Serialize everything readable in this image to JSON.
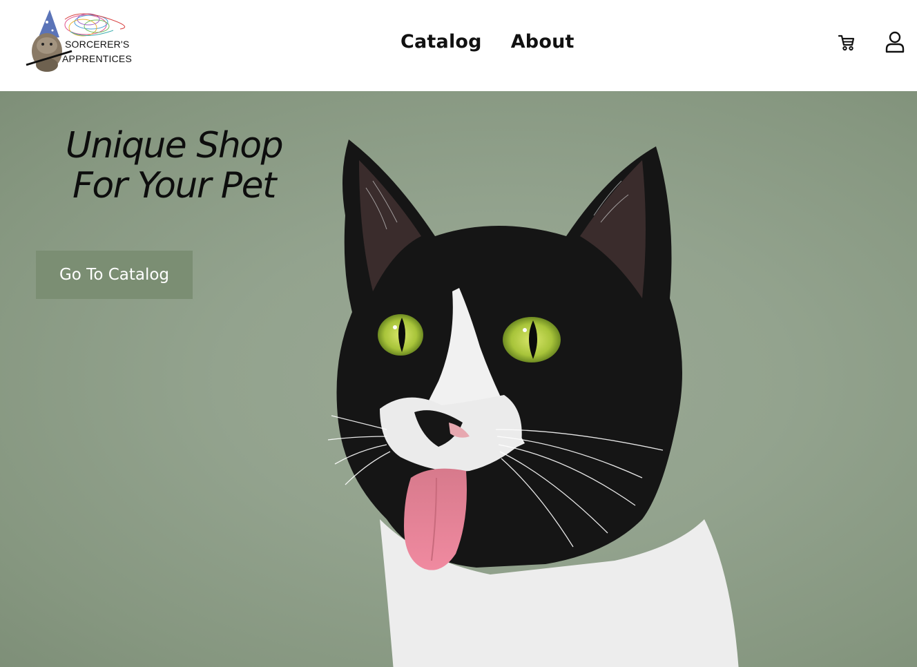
{
  "brand": {
    "logo_line1": "SORCERER'S",
    "logo_line2": "APPRENTICES"
  },
  "nav": {
    "items": [
      {
        "label": "Catalog"
      },
      {
        "label": "About"
      }
    ]
  },
  "header_icons": {
    "cart": "cart-icon",
    "account": "user-icon"
  },
  "hero": {
    "headline_line1": "Unique Shop",
    "headline_line2": "For Your Pet",
    "cta_label": "Go To Catalog",
    "image": "cat-photo"
  },
  "colors": {
    "hero_background": "#93a38e",
    "cta_background": "#7b8e73",
    "text": "#111111"
  }
}
